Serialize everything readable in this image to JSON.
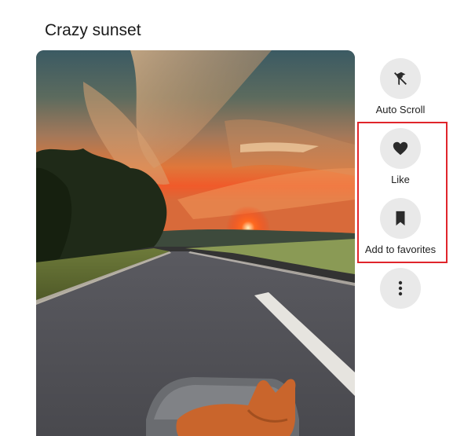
{
  "post": {
    "title": "Crazy sunset"
  },
  "actions": {
    "auto_scroll": {
      "label": "Auto Scroll",
      "icon": "auto-scroll-icon"
    },
    "like": {
      "label": "Like",
      "icon": "heart-icon"
    },
    "favorites": {
      "label": "Add to favorites",
      "icon": "bookmark-icon"
    },
    "more": {
      "icon": "more-vertical-icon"
    }
  },
  "colors": {
    "button_bg": "#e9e9e9",
    "icon": "#2b2b2b",
    "highlight": "#e0252b"
  }
}
